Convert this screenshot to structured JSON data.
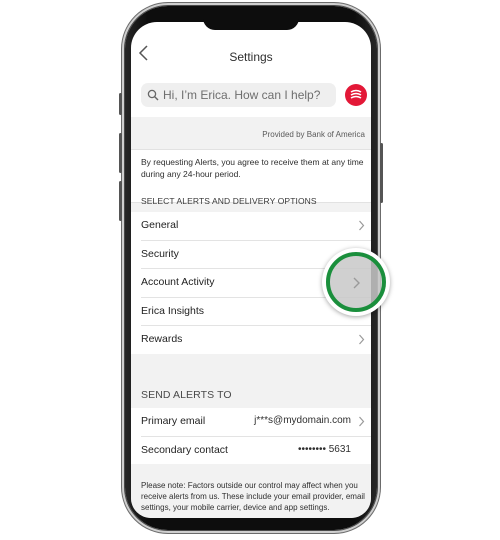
{
  "header": {
    "title": "Settings",
    "back_icon": "chevron-left-icon"
  },
  "search": {
    "placeholder": "Hi, I’m Erica. How can I help?",
    "icon": "search-icon",
    "logo_icon": "erica-logo-icon"
  },
  "provided_by": "Provided by Bank of America",
  "disclaimer": "By requesting Alerts, you agree to receive them at any time during any 24-hour period.",
  "alerts_section": {
    "heading": "SELECT ALERTS AND DELIVERY OPTIONS",
    "items": [
      {
        "label": "General"
      },
      {
        "label": "Security"
      },
      {
        "label": "Account Activity"
      },
      {
        "label": "Erica Insights"
      },
      {
        "label": "Rewards"
      }
    ]
  },
  "send_section": {
    "heading": "SEND ALERTS TO",
    "items": [
      {
        "label": "Primary email",
        "value": "j***s@mydomain.com"
      },
      {
        "label": "Secondary contact",
        "value": "•••••••• 5631"
      }
    ]
  },
  "note": "Please note: Factors outside our control may affect when you receive alerts from us.  These include your email provider, email settings, your mobile carrier, device and app settings.",
  "colors": {
    "brand_red": "#e31837",
    "highlight_green": "#1a8f3c",
    "background_gray": "#f2f2f2"
  }
}
